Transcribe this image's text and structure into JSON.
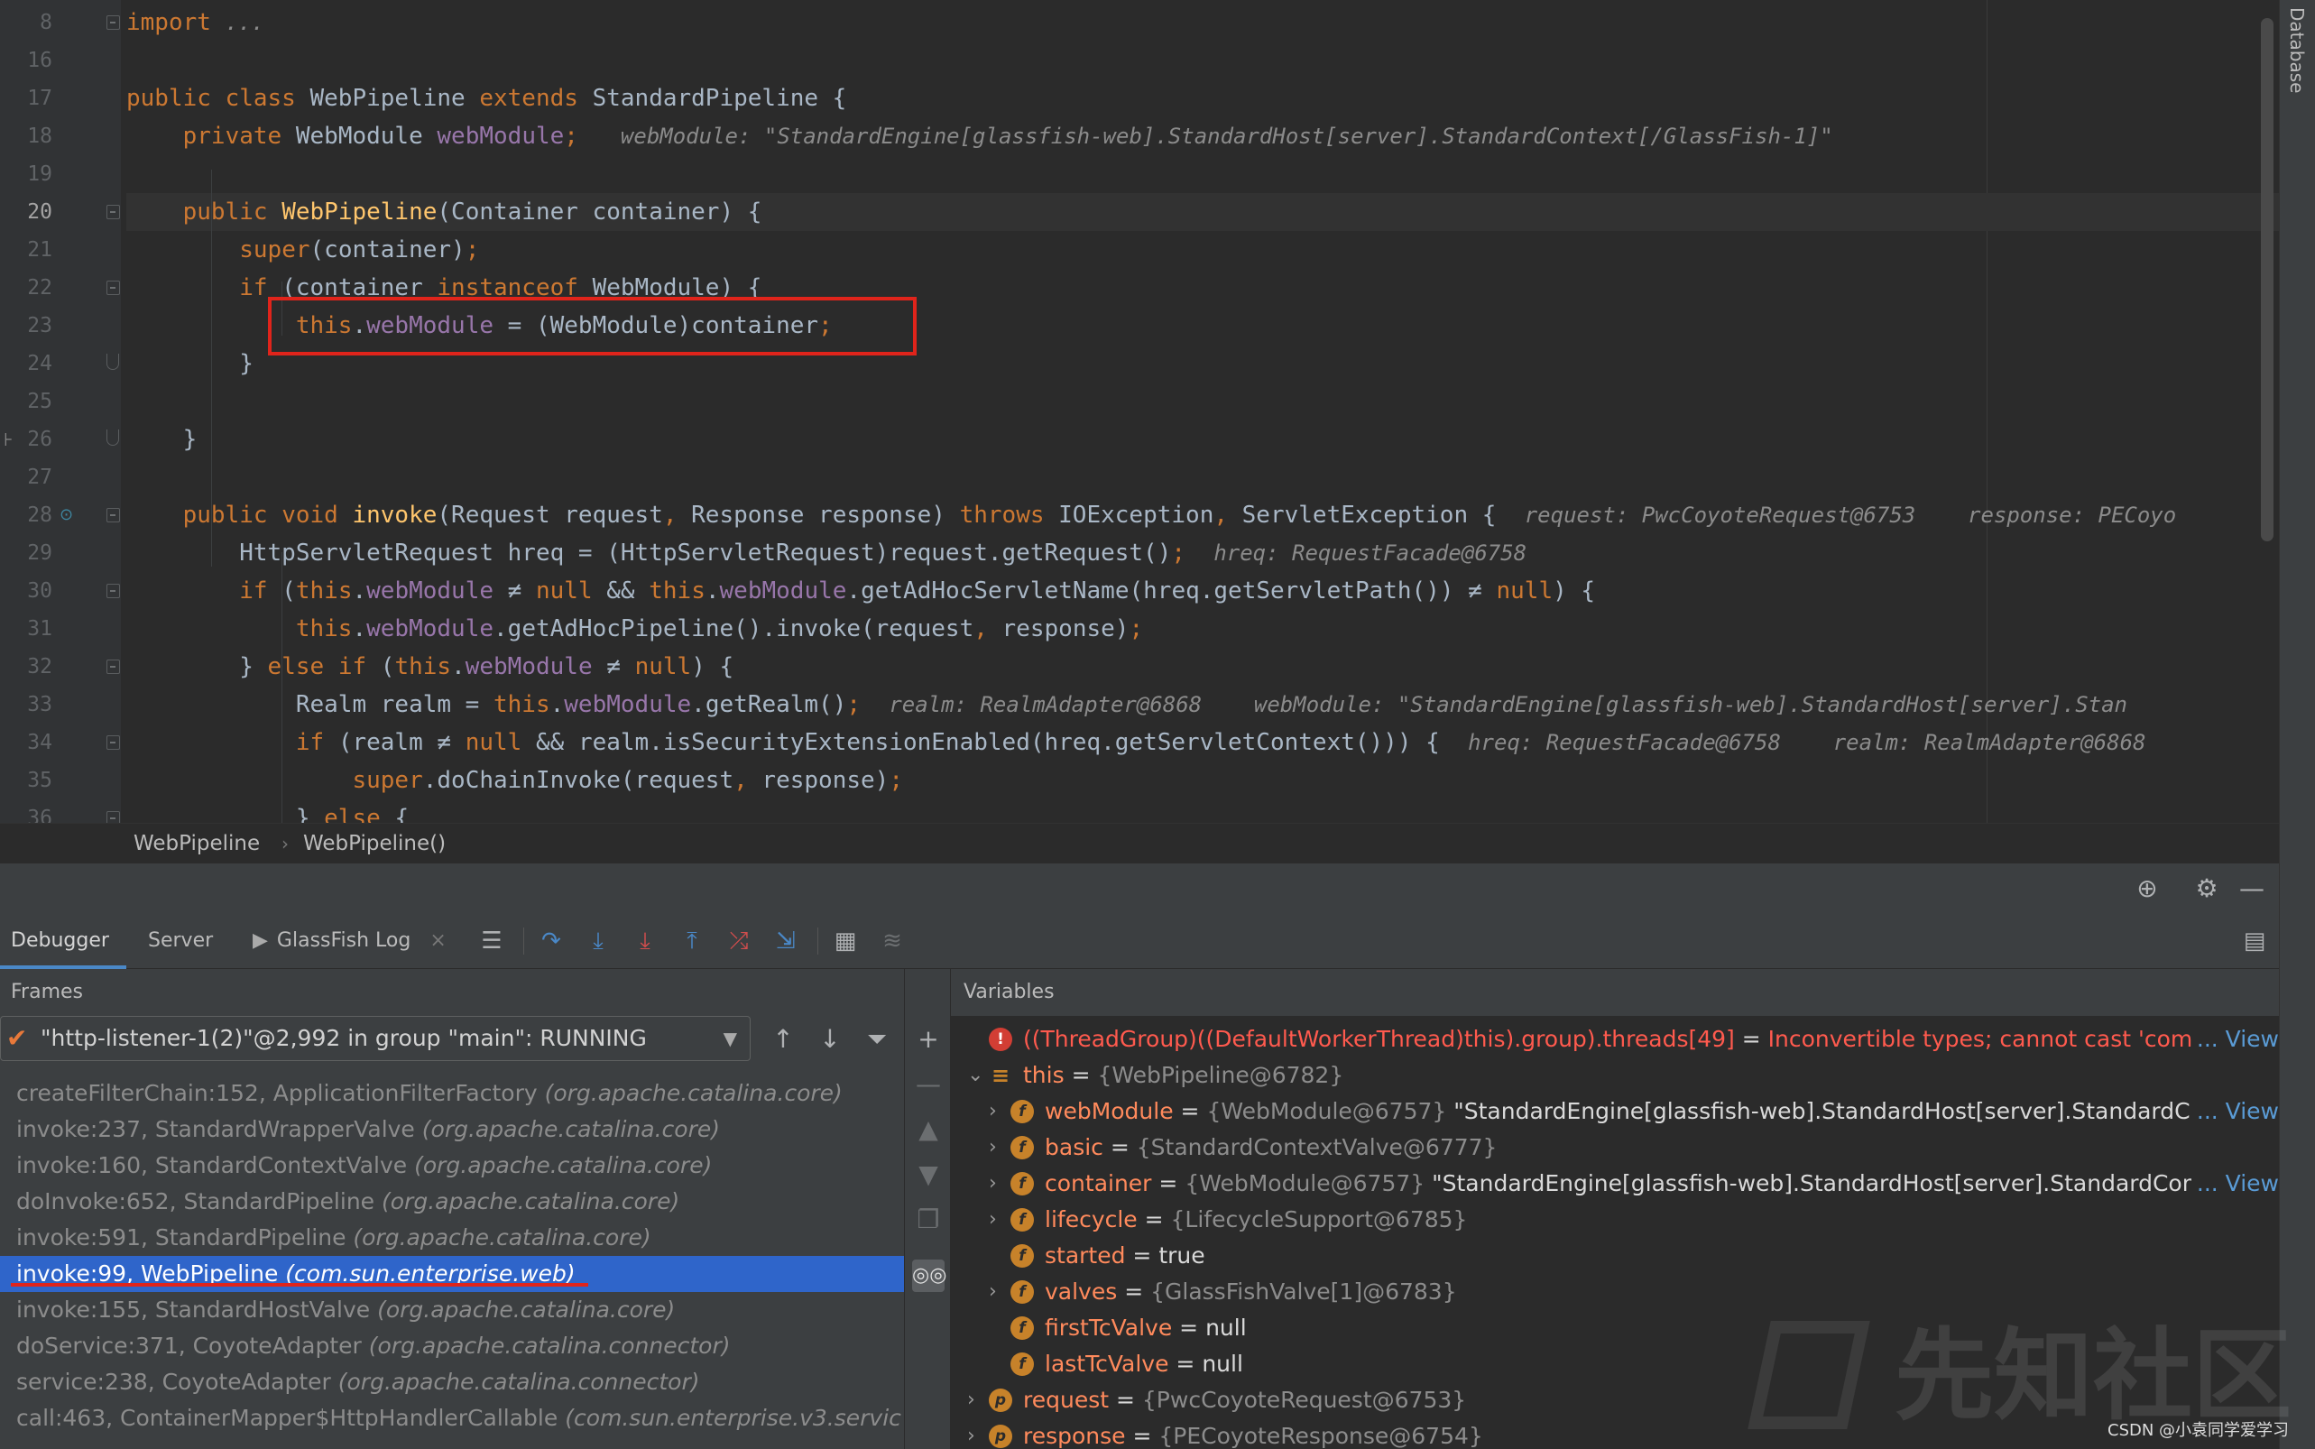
{
  "editor": {
    "lines": [
      {
        "num": "8",
        "tokens": [
          [
            "kw",
            "import"
          ],
          [
            "",
            " "
          ],
          [
            "inl",
            "..."
          ]
        ]
      },
      {
        "num": "16",
        "tokens": []
      },
      {
        "num": "17",
        "tokens": [
          [
            "kw",
            "public class "
          ],
          [
            "",
            "WebPipeline "
          ],
          [
            "kw",
            "extends "
          ],
          [
            "",
            "StandardPipeline {"
          ]
        ]
      },
      {
        "num": "18",
        "tokens": [
          [
            "",
            "    "
          ],
          [
            "kw",
            "private "
          ],
          [
            "",
            "WebModule "
          ],
          [
            "fld",
            "webModule"
          ],
          [
            "kw",
            ";"
          ],
          [
            "",
            "   "
          ],
          [
            "inl",
            "webModule: \"StandardEngine[glassfish-web].StandardHost[server].StandardContext[/GlassFish-1]\""
          ]
        ]
      },
      {
        "num": "19",
        "tokens": []
      },
      {
        "num": "20",
        "tokens": [
          [
            "",
            "    "
          ],
          [
            "kw",
            "public "
          ],
          [
            "fn",
            "WebPipeline"
          ],
          [
            "",
            "(Container container) {"
          ]
        ]
      },
      {
        "num": "21",
        "tokens": [
          [
            "",
            "        "
          ],
          [
            "kw",
            "super"
          ],
          [
            "",
            "(container)"
          ],
          [
            "kw",
            ";"
          ]
        ]
      },
      {
        "num": "22",
        "tokens": [
          [
            "",
            "        "
          ],
          [
            "kw",
            "if "
          ],
          [
            "",
            "(container "
          ],
          [
            "kw",
            "instanceof "
          ],
          [
            "",
            "WebModule) {"
          ]
        ]
      },
      {
        "num": "23",
        "tokens": [
          [
            "",
            "            "
          ],
          [
            "kw",
            "this"
          ],
          [
            "",
            "."
          ],
          [
            "fld",
            "webModule"
          ],
          [
            "",
            " = (WebModule)container"
          ],
          [
            "kw",
            ";"
          ]
        ]
      },
      {
        "num": "24",
        "tokens": [
          [
            "",
            "        }"
          ]
        ]
      },
      {
        "num": "25",
        "tokens": []
      },
      {
        "num": "26",
        "tokens": [
          [
            "",
            "    }"
          ]
        ]
      },
      {
        "num": "27",
        "tokens": []
      },
      {
        "num": "28",
        "tokens": [
          [
            "",
            "    "
          ],
          [
            "kw",
            "public void "
          ],
          [
            "fn",
            "invoke"
          ],
          [
            "",
            "(Request request"
          ],
          [
            "kw",
            ", "
          ],
          [
            "",
            "Response response) "
          ],
          [
            "kw",
            "throws "
          ],
          [
            "",
            "IOException"
          ],
          [
            "kw",
            ", "
          ],
          [
            "",
            "ServletException {  "
          ],
          [
            "inl",
            "request: PwcCoyoteRequest@6753    response: PECoyo"
          ]
        ]
      },
      {
        "num": "29",
        "tokens": [
          [
            "",
            "        HttpServletRequest hreq = (HttpServletRequest)request.getRequest()"
          ],
          [
            "kw",
            ";"
          ],
          [
            "",
            "  "
          ],
          [
            "inl",
            "hreq: RequestFacade@6758"
          ]
        ]
      },
      {
        "num": "30",
        "tokens": [
          [
            "",
            "        "
          ],
          [
            "kw",
            "if "
          ],
          [
            "",
            "("
          ],
          [
            "kw",
            "this"
          ],
          [
            "",
            "."
          ],
          [
            "fld",
            "webModule"
          ],
          [
            "",
            " ≠ "
          ],
          [
            "kw",
            "null "
          ],
          [
            "",
            "&& "
          ],
          [
            "kw",
            "this"
          ],
          [
            "",
            "."
          ],
          [
            "fld",
            "webModule"
          ],
          [
            "",
            ".getAdHocServletName(hreq.getServletPath()) ≠ "
          ],
          [
            "kw",
            "null"
          ],
          [
            "",
            ") {"
          ]
        ]
      },
      {
        "num": "31",
        "tokens": [
          [
            "",
            "            "
          ],
          [
            "kw",
            "this"
          ],
          [
            "",
            "."
          ],
          [
            "fld",
            "webModule"
          ],
          [
            "",
            ".getAdHocPipeline().invoke(request"
          ],
          [
            "kw",
            ", "
          ],
          [
            "",
            "response)"
          ],
          [
            "kw",
            ";"
          ]
        ]
      },
      {
        "num": "32",
        "tokens": [
          [
            "",
            "        } "
          ],
          [
            "kw",
            "else if "
          ],
          [
            "",
            "("
          ],
          [
            "kw",
            "this"
          ],
          [
            "",
            "."
          ],
          [
            "fld",
            "webModule"
          ],
          [
            "",
            " ≠ "
          ],
          [
            "kw",
            "null"
          ],
          [
            "",
            ") {"
          ]
        ]
      },
      {
        "num": "33",
        "tokens": [
          [
            "",
            "            Realm realm = "
          ],
          [
            "kw",
            "this"
          ],
          [
            "",
            "."
          ],
          [
            "fld",
            "webModule"
          ],
          [
            "",
            ".getRealm()"
          ],
          [
            "kw",
            ";"
          ],
          [
            "",
            "  "
          ],
          [
            "inl",
            "realm: RealmAdapter@6868    webModule: \"StandardEngine[glassfish-web].StandardHost[server].Stan"
          ]
        ]
      },
      {
        "num": "34",
        "tokens": [
          [
            "",
            "            "
          ],
          [
            "kw",
            "if "
          ],
          [
            "",
            "(realm ≠ "
          ],
          [
            "kw",
            "null "
          ],
          [
            "",
            "&& realm.isSecurityExtensionEnabled(hreq.getServletContext())) {  "
          ],
          [
            "inl",
            "hreq: RequestFacade@6758    realm: RealmAdapter@6868"
          ]
        ]
      },
      {
        "num": "35",
        "tokens": [
          [
            "",
            "                "
          ],
          [
            "kw",
            "super"
          ],
          [
            "",
            ".doChainInvoke(request"
          ],
          [
            "kw",
            ", "
          ],
          [
            "",
            "response)"
          ],
          [
            "kw",
            ";"
          ]
        ]
      },
      {
        "num": "36",
        "tokens": [
          [
            "",
            "            } "
          ],
          [
            "kw",
            "else "
          ],
          [
            "",
            "{"
          ]
        ]
      }
    ],
    "current_line": "20"
  },
  "vertical_tab": {
    "label": "Database"
  },
  "breadcrumb": {
    "class_name": "WebPipeline",
    "separator": "›",
    "method_name": "WebPipeline()"
  },
  "debugger": {
    "tabs": {
      "debugger": "Debugger",
      "server": "Server",
      "glassfish_log": "GlassFish Log",
      "close": "×"
    },
    "frames_title": "Frames",
    "variables_title": "Variables",
    "thread": {
      "check": "✔",
      "label": "\"http-listener-1(2)\"@2,992 in group \"main\": RUNNING",
      "caret": "▼"
    },
    "frames": [
      {
        "loc": "createFilterChain:152, ApplicationFilterFactory ",
        "pkg": "(org.apache.catalina.core)"
      },
      {
        "loc": "invoke:237, StandardWrapperValve ",
        "pkg": "(org.apache.catalina.core)"
      },
      {
        "loc": "invoke:160, StandardContextValve ",
        "pkg": "(org.apache.catalina.core)"
      },
      {
        "loc": "doInvoke:652, StandardPipeline ",
        "pkg": "(org.apache.catalina.core)"
      },
      {
        "loc": "invoke:591, StandardPipeline ",
        "pkg": "(org.apache.catalina.core)"
      },
      {
        "loc": "invoke:99, WebPipeline ",
        "pkg": "(com.sun.enterprise.web)",
        "selected": true
      },
      {
        "loc": "invoke:155, StandardHostValve ",
        "pkg": "(org.apache.catalina.core)"
      },
      {
        "loc": "doService:371, CoyoteAdapter ",
        "pkg": "(org.apache.catalina.connector)"
      },
      {
        "loc": "service:238, CoyoteAdapter ",
        "pkg": "(org.apache.catalina.connector)"
      },
      {
        "loc": "call:463, ContainerMapper$HttpHandlerCallable ",
        "pkg": "(com.sun.enterprise.v3.servic"
      }
    ],
    "variables": [
      {
        "level": 0,
        "arrow": "",
        "badge": "!",
        "badge_type": "err",
        "name": "((ThreadGroup)((DefaultWorkerThread)this).group).threads[49]",
        "eq": " = ",
        "type": "",
        "value": "Inconvertible types; cannot cast 'com.:",
        "value_class": "verr",
        "link": "... View"
      },
      {
        "level": 0,
        "arrow": "⌄",
        "badge": "≡",
        "badge_type": "stack",
        "name": "this",
        "eq": " = ",
        "type": "{WebPipeline@6782}",
        "value": "",
        "value_class": "vval",
        "link": ""
      },
      {
        "level": 1,
        "arrow": "›",
        "badge": "f",
        "badge_type": "f",
        "name": "webModule",
        "eq": " = ",
        "type": "{WebModule@6757} ",
        "value": "\"StandardEngine[glassfish-web].StandardHost[server].StandardC",
        "value_class": "vval",
        "link": "... View"
      },
      {
        "level": 1,
        "arrow": "›",
        "badge": "f",
        "badge_type": "f",
        "name": "basic",
        "eq": " = ",
        "type": "{StandardContextValve@6777}",
        "value": "",
        "value_class": "vval",
        "link": ""
      },
      {
        "level": 1,
        "arrow": "›",
        "badge": "f",
        "badge_type": "f",
        "name": "container",
        "eq": " = ",
        "type": "{WebModule@6757} ",
        "value": "\"StandardEngine[glassfish-web].StandardHost[server].StandardCon",
        "value_class": "vval",
        "link": "... View"
      },
      {
        "level": 1,
        "arrow": "›",
        "badge": "f",
        "badge_type": "f",
        "name": "lifecycle",
        "eq": " = ",
        "type": "{LifecycleSupport@6785}",
        "value": "",
        "value_class": "vval",
        "link": ""
      },
      {
        "level": 1,
        "arrow": "",
        "badge": "f",
        "badge_type": "f",
        "name": "started",
        "eq": " = ",
        "type": "",
        "value": "true",
        "value_class": "vval",
        "link": ""
      },
      {
        "level": 1,
        "arrow": "›",
        "badge": "f",
        "badge_type": "f",
        "name": "valves",
        "eq": " = ",
        "type": "{GlassFishValve[1]@6783}",
        "value": "",
        "value_class": "vval",
        "link": ""
      },
      {
        "level": 1,
        "arrow": "",
        "badge": "f",
        "badge_type": "f",
        "name": "firstTcValve",
        "eq": " = ",
        "type": "",
        "value": "null",
        "value_class": "vval",
        "link": ""
      },
      {
        "level": 1,
        "arrow": "",
        "badge": "f",
        "badge_type": "f",
        "name": "lastTcValve",
        "eq": " = ",
        "type": "",
        "value": "null",
        "value_class": "vval",
        "link": ""
      },
      {
        "level": 0,
        "arrow": "›",
        "badge": "p",
        "badge_type": "p",
        "name": "request",
        "eq": " = ",
        "type": "{PwcCoyoteRequest@6753}",
        "value": "",
        "value_class": "vval",
        "link": ""
      },
      {
        "level": 0,
        "arrow": "›",
        "badge": "p",
        "badge_type": "p",
        "name": "response",
        "eq": " = ",
        "type": "{PECoyoteResponse@6754}",
        "value": "",
        "value_class": "vval",
        "link": ""
      }
    ]
  },
  "watermark": {
    "text": "先知社区"
  },
  "csdn": {
    "text": "CSDN @小袁同学爱学习"
  },
  "colors": {
    "accent": "#2f65ca",
    "highlight_box": "#e0241b",
    "keyword": "#cc7832",
    "field": "#9876aa",
    "function": "#ffc66d"
  }
}
